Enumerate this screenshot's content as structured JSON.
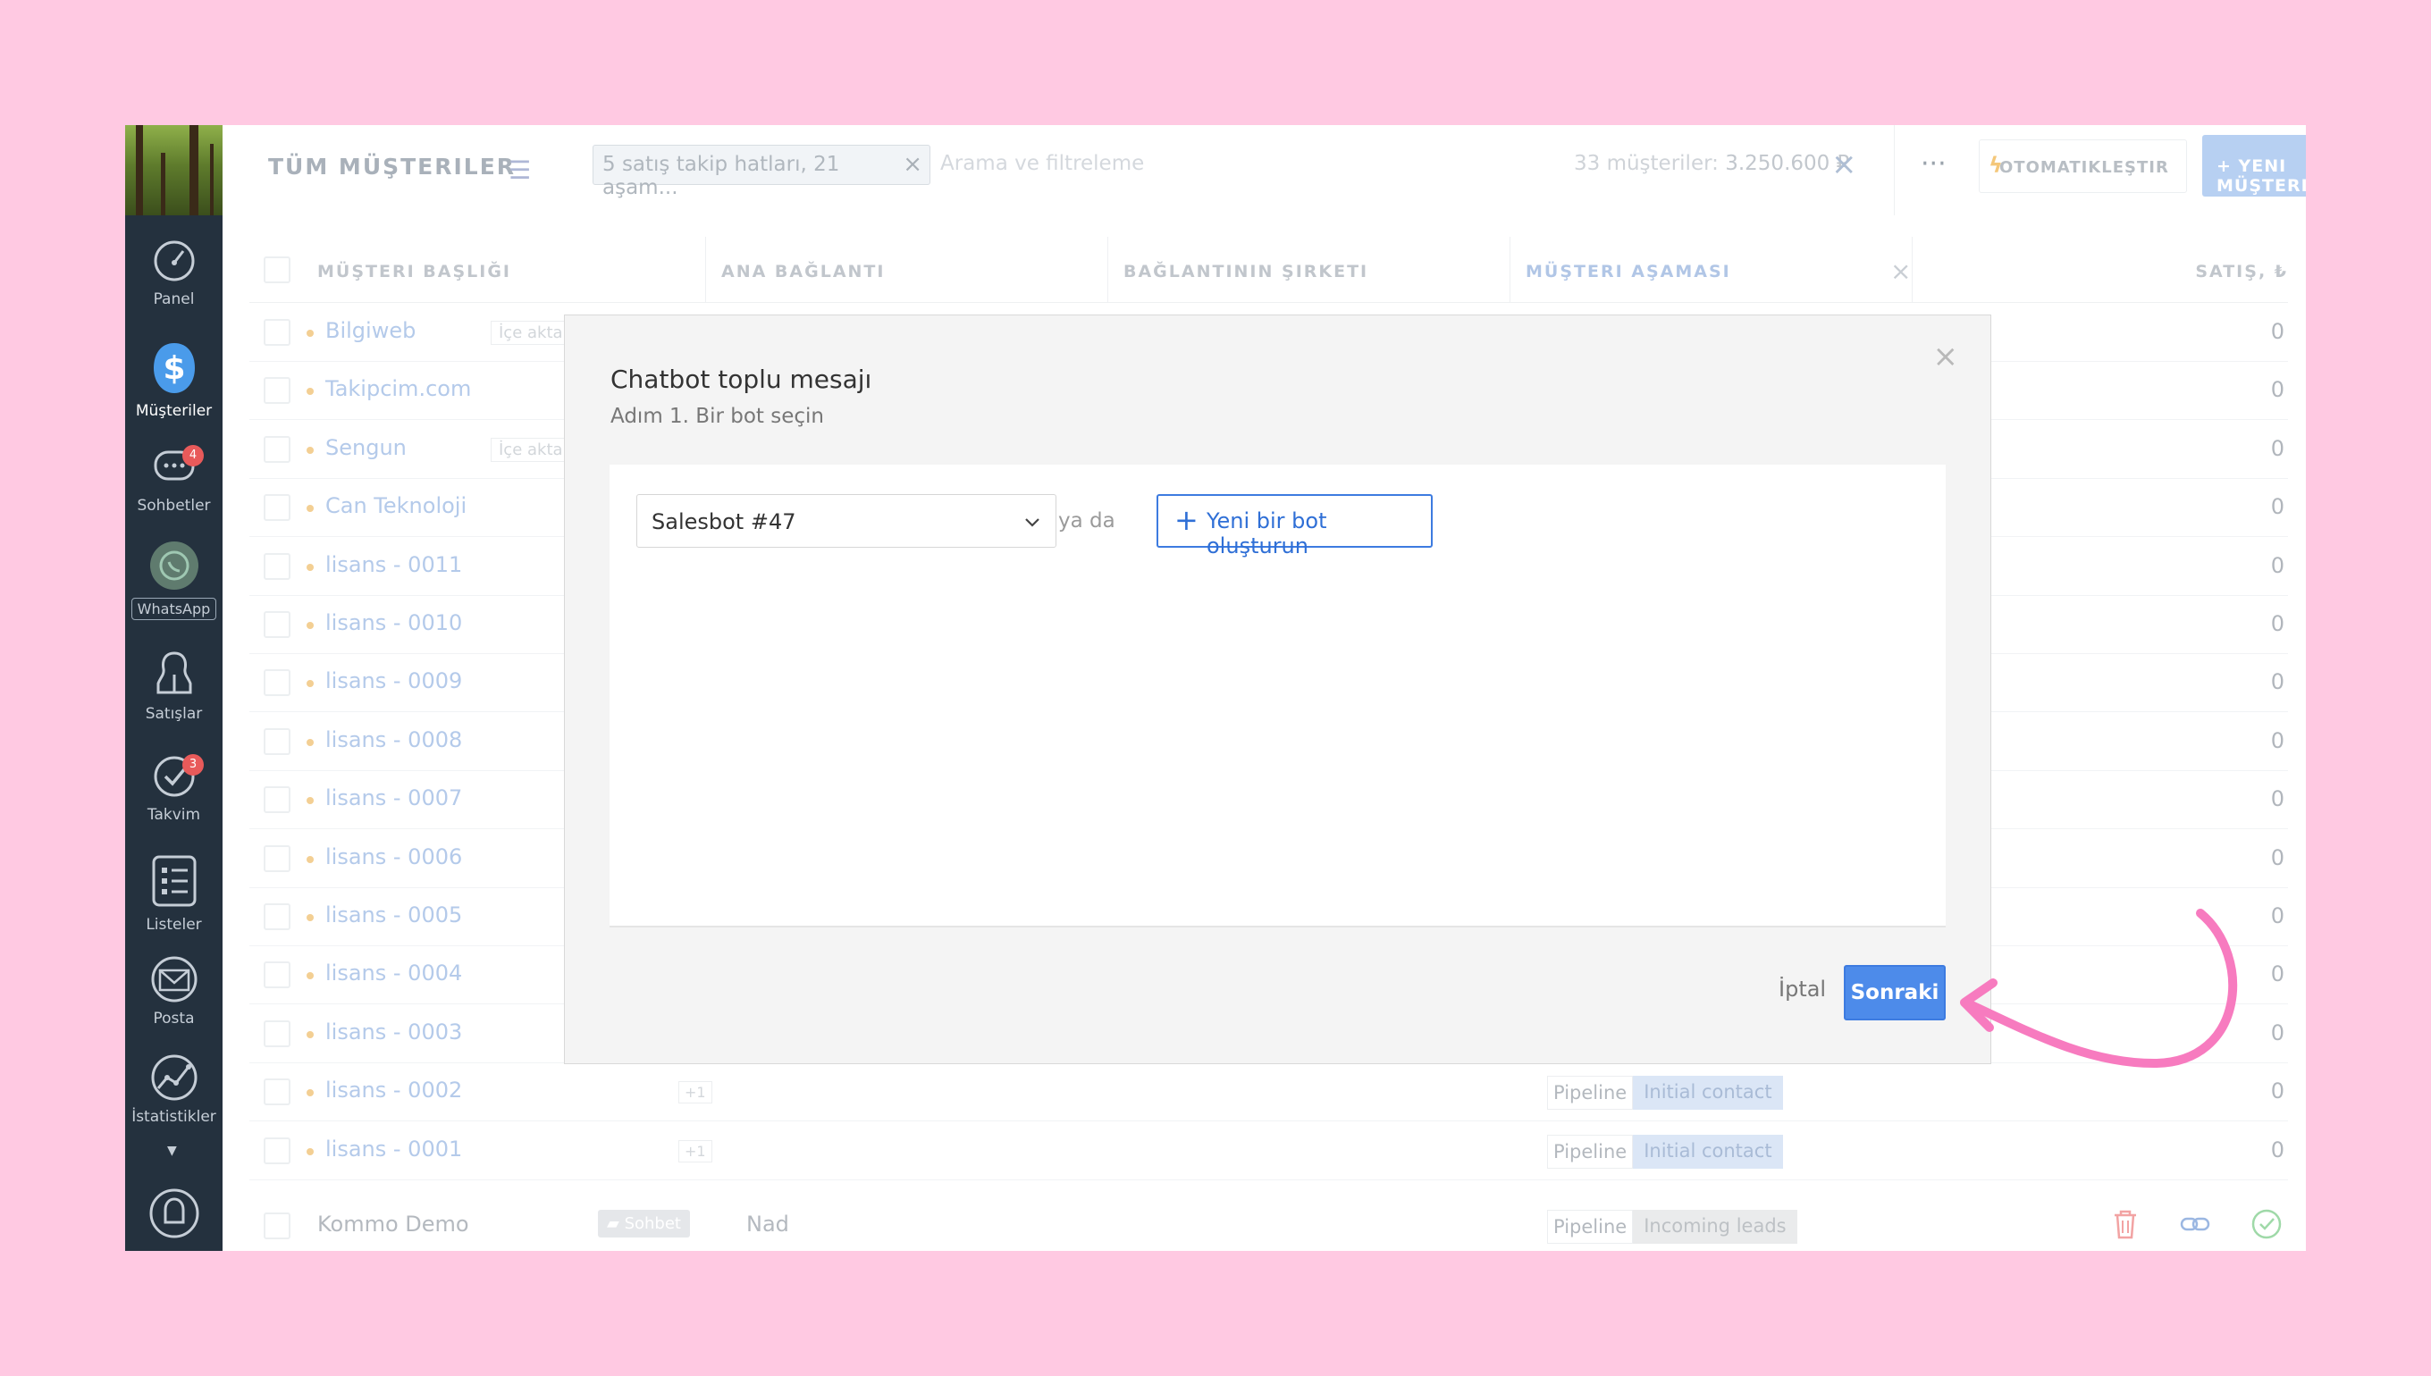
{
  "sidebar": {
    "items": [
      {
        "label": "Panel",
        "icon": "gauge-icon"
      },
      {
        "label": "Müşteriler",
        "icon": "dollar-icon",
        "active": true
      },
      {
        "label": "Sohbetler",
        "icon": "chat-icon",
        "badge": "4"
      },
      {
        "label": "WhatsApp",
        "icon": "whatsapp-icon"
      },
      {
        "label": "Satışlar",
        "icon": "people-icon"
      },
      {
        "label": "Takvim",
        "icon": "check-icon",
        "badge": "3"
      },
      {
        "label": "Listeler",
        "icon": "list-icon"
      },
      {
        "label": "Posta",
        "icon": "mail-icon"
      },
      {
        "label": "İstatistikler",
        "icon": "stats-icon"
      }
    ]
  },
  "topbar": {
    "title": "TÜM MÜŞTERILER",
    "filter_chip": "5 satış takip hatları, 21 aşam...",
    "search_placeholder": "Arama ve filtreleme",
    "count_label": "33 müşteriler:",
    "count_value": "3.250.600 ₽",
    "automate_label": "OTOMATIKLEŞTIR",
    "new_customer_label": "+ YENI MÜŞTERI"
  },
  "table": {
    "columns": [
      "MÜŞTERI BAŞLIĞI",
      "ANA BAĞLANTI",
      "BAĞLANTININ ŞIRKETI",
      "MÜŞTERI AŞAMASI",
      "SATIŞ, ₺"
    ],
    "rows": [
      {
        "name": "Bilgiweb",
        "tag": "İçe aktar_(",
        "sales": "0"
      },
      {
        "name": "Takipcim.com",
        "sales": "0"
      },
      {
        "name": "Sengun",
        "tag": "İçe aktar_(",
        "sales": "0"
      },
      {
        "name": "Can Teknoloji",
        "sales": "0"
      },
      {
        "name": "lisans - 0011",
        "sales": "0"
      },
      {
        "name": "lisans - 0010",
        "sales": "0"
      },
      {
        "name": "lisans - 0009",
        "sales": "0"
      },
      {
        "name": "lisans - 0008",
        "sales": "0"
      },
      {
        "name": "lisans - 0007",
        "sales": "0"
      },
      {
        "name": "lisans - 0006",
        "sales": "0"
      },
      {
        "name": "lisans - 0005",
        "sales": "0"
      },
      {
        "name": "lisans - 0004",
        "sales": "0"
      },
      {
        "name": "lisans - 0003",
        "sales": "0"
      },
      {
        "name": "lisans - 0002",
        "plus": "+1",
        "pipeline": "Pipeline",
        "stage": "Initial contact",
        "sales": "0"
      },
      {
        "name": "lisans - 0001",
        "plus": "+1",
        "pipeline": "Pipeline",
        "stage": "Initial contact",
        "sales": "0"
      }
    ],
    "last_row": {
      "name": "Kommo Demo",
      "chat_tag": "Sohbet",
      "contact": "Nad",
      "pipeline": "Pipeline",
      "stage": "Incoming leads"
    }
  },
  "modal": {
    "title": "Chatbot toplu mesajı",
    "subtitle": "Adım 1. Bir bot seçin",
    "select_value": "Salesbot #47",
    "or_text": "ya da",
    "create_label": "Yeni bir bot oluşturun",
    "cancel_label": "İptal",
    "next_label": "Sonraki"
  },
  "colors": {
    "accent": "#4d8bea",
    "sidebar_bg": "#24313e",
    "frame_bg": "#ffc9e2",
    "arrow": "#f77bbf"
  }
}
